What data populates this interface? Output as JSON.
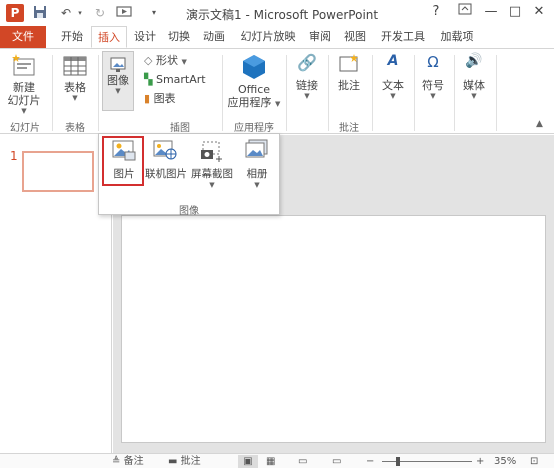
{
  "window": {
    "title": "演示文稿1 - Microsoft PowerPoint",
    "app_icon_letter": "P",
    "help": "?",
    "minimize": "—",
    "restore": "□",
    "close": "✕"
  },
  "tabs": {
    "file": "文件",
    "home": "开始",
    "insert": "插入",
    "design": "设计",
    "transitions": "切换",
    "animations": "动画",
    "slideshow": "幻灯片放映",
    "review": "审阅",
    "view": "视图",
    "developer": "开发工具",
    "addins": "加载项"
  },
  "ribbon": {
    "new_slide_line1": "新建",
    "new_slide_line2": "幻灯片",
    "table": "表格",
    "images": "图像",
    "shapes": "形状",
    "smartart": "SmartArt",
    "chart": "图表",
    "office_apps_line1": "Office",
    "office_apps_line2": "应用程序",
    "link": "链接",
    "comment": "批注",
    "text": "文本",
    "symbols": "符号",
    "media": "媒体",
    "groups": {
      "slides": "幻灯片",
      "tables": "表格",
      "illustrations": "插图",
      "apps": "应用程序",
      "comments": "批注"
    }
  },
  "popup": {
    "picture": "图片",
    "online_picture": "联机图片",
    "screenshot": "屏幕截图",
    "album": "相册",
    "group_label": "图像"
  },
  "thumbs": {
    "slide_number": "1"
  },
  "status": {
    "notes": "备注",
    "comments": "批注",
    "zoom": "35%"
  },
  "colors": {
    "accent": "#d24726",
    "highlight_box": "#d32f2f",
    "office_blue": "#1e73be"
  }
}
